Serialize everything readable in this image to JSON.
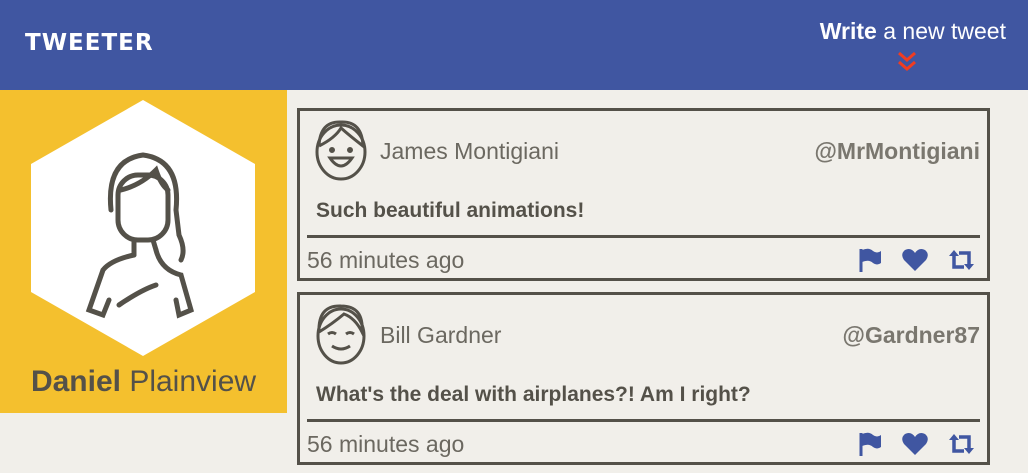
{
  "header": {
    "logo": "TWEETER",
    "write_bold": "Write",
    "write_rest": " a new tweet"
  },
  "profile": {
    "first": "Daniel",
    "last": " Plainview"
  },
  "tweets": [
    {
      "name": "James Montigiani",
      "handle": "@MrMontigiani",
      "text": "Such beautiful animations!",
      "time": "56 minutes ago"
    },
    {
      "name": "Bill Gardner",
      "handle": "@Gardner87",
      "text": "What's the deal with airplanes?! Am I right?",
      "time": "56 minutes ago"
    }
  ],
  "colors": {
    "brand": "#4056a1",
    "accent": "#f13c20",
    "yellow": "#f4c02e",
    "dark": "#545149"
  }
}
